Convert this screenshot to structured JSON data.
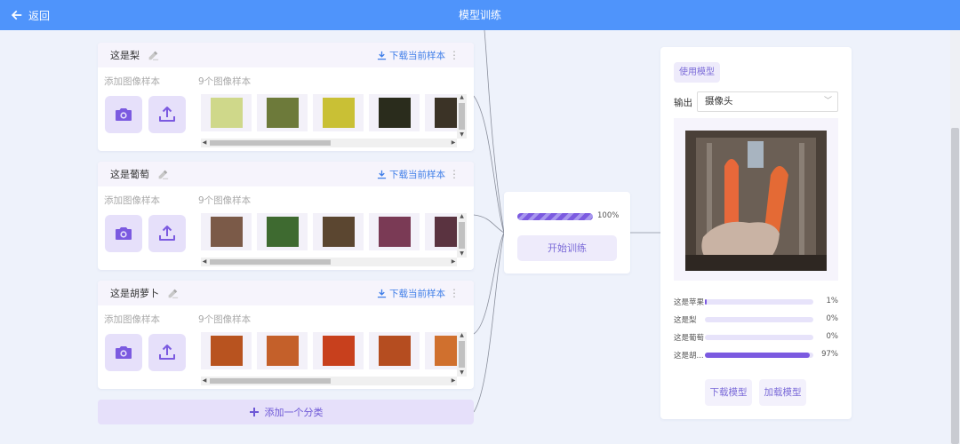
{
  "header": {
    "back_label": "返回",
    "title": "模型训练"
  },
  "classes": [
    {
      "name": "这是梨",
      "download_label": "下载当前样本",
      "add_label": "添加图像样本",
      "count_label": "9个图像样本",
      "thumb_colors": [
        "#cfd88a",
        "#6d7a3a",
        "#c9c035",
        "#2a2c1c",
        "#3b3326"
      ]
    },
    {
      "name": "这是葡萄",
      "download_label": "下载当前样本",
      "add_label": "添加图像样本",
      "count_label": "9个图像样本",
      "thumb_colors": [
        "#7b5a48",
        "#3e6a30",
        "#5b4630",
        "#7a3a55",
        "#5a3340"
      ]
    },
    {
      "name": "这是胡萝卜",
      "download_label": "下载当前样本",
      "add_label": "添加图像样本",
      "count_label": "9个图像样本",
      "thumb_colors": [
        "#b8531f",
        "#c4602a",
        "#c8401d",
        "#b54d20",
        "#d0702e"
      ]
    }
  ],
  "add_category_label": "添加一个分类",
  "training": {
    "progress": 1.0,
    "progress_text": "100%",
    "button_label": "开始训练"
  },
  "model": {
    "use_button": "使用模型",
    "output_label": "输出",
    "output_value": "摄像头",
    "predictions": [
      {
        "label": "这是苹果",
        "value": 0.01,
        "text": "1%"
      },
      {
        "label": "这是梨",
        "value": 0.0,
        "text": "0%"
      },
      {
        "label": "这是葡萄",
        "value": 0.0,
        "text": "0%"
      },
      {
        "label": "这是胡...",
        "value": 0.97,
        "text": "97%"
      }
    ],
    "download_button": "下载模型",
    "load_button": "加载模型"
  },
  "colors": {
    "header": "#4f94fb",
    "accent": "#7b5ae0",
    "link": "#3f7ee8"
  }
}
